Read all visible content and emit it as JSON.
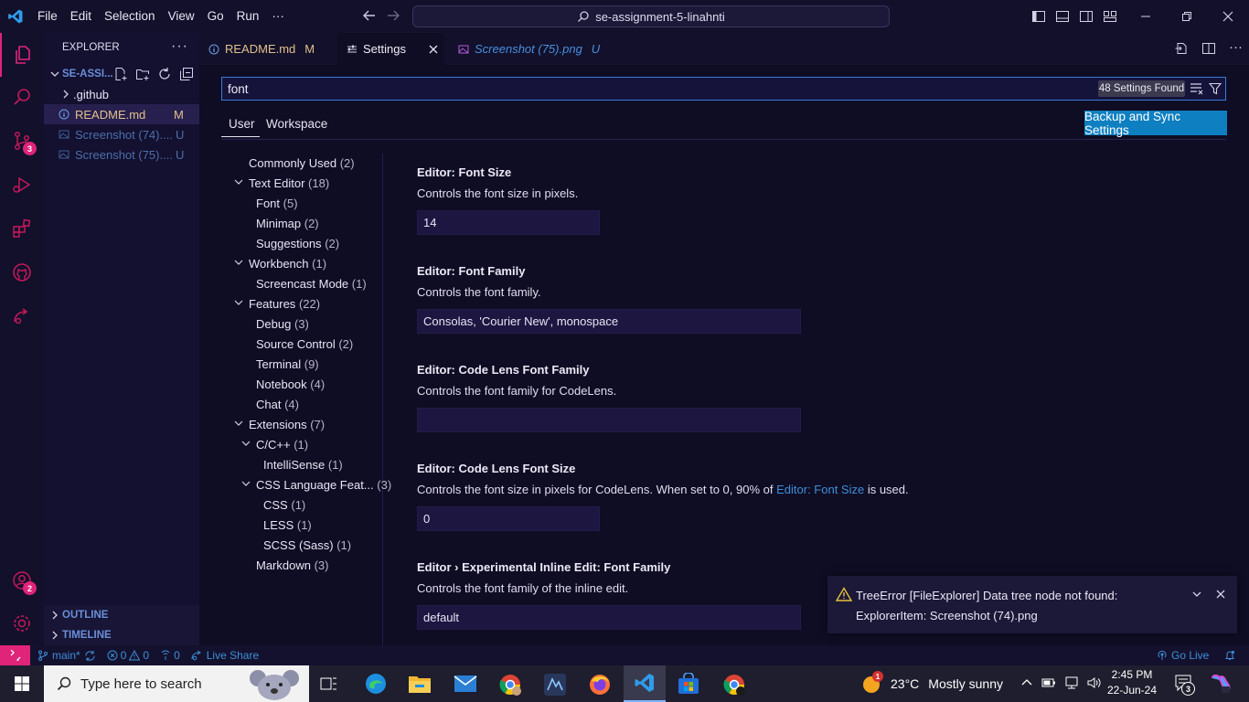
{
  "menu": [
    "File",
    "Edit",
    "Selection",
    "View",
    "Go",
    "Run",
    "···"
  ],
  "command_center": "se-assignment-5-linahnti",
  "activity_badges": {
    "source_control": "3",
    "accounts": "2"
  },
  "explorer": {
    "title": "EXPLORER",
    "folder": "SE-ASSI...",
    "items": [
      {
        "name": ".github",
        "status": ""
      },
      {
        "name": "README.md",
        "status": "M"
      },
      {
        "name": "Screenshot (74)....",
        "status": "U"
      },
      {
        "name": "Screenshot (75)....",
        "status": "U"
      }
    ],
    "outline": "OUTLINE",
    "timeline": "TIMELINE"
  },
  "tabs": [
    {
      "label": "README.md",
      "status": "M"
    },
    {
      "label": "Settings",
      "status": ""
    },
    {
      "label": "Screenshot (75).png",
      "status": "U"
    }
  ],
  "settings": {
    "query": "font",
    "count": "48 Settings Found",
    "scope_tabs": [
      "User",
      "Workspace"
    ],
    "sync_button": "Backup and Sync Settings",
    "toc": [
      {
        "label": "Commonly Used",
        "count": "(2)"
      },
      {
        "label": "Text Editor",
        "count": "(18)"
      },
      {
        "label": "Font",
        "count": "(5)"
      },
      {
        "label": "Minimap",
        "count": "(2)"
      },
      {
        "label": "Suggestions",
        "count": "(2)"
      },
      {
        "label": "Workbench",
        "count": "(1)"
      },
      {
        "label": "Screencast Mode",
        "count": "(1)"
      },
      {
        "label": "Features",
        "count": "(22)"
      },
      {
        "label": "Debug",
        "count": "(3)"
      },
      {
        "label": "Source Control",
        "count": "(2)"
      },
      {
        "label": "Terminal",
        "count": "(9)"
      },
      {
        "label": "Notebook",
        "count": "(4)"
      },
      {
        "label": "Chat",
        "count": "(4)"
      },
      {
        "label": "Extensions",
        "count": "(7)"
      },
      {
        "label": "C/C++",
        "count": "(1)"
      },
      {
        "label": "IntelliSense",
        "count": "(1)"
      },
      {
        "label": "CSS Language Feat...",
        "count": "(3)"
      },
      {
        "label": "CSS",
        "count": "(1)"
      },
      {
        "label": "LESS",
        "count": "(1)"
      },
      {
        "label": "SCSS (Sass)",
        "count": "(1)"
      },
      {
        "label": "Markdown",
        "count": "(3)"
      }
    ],
    "items": [
      {
        "title": "Editor: Font Size",
        "desc": "Controls the font size in pixels.",
        "value": "14"
      },
      {
        "title": "Editor: Font Family",
        "desc": "Controls the font family.",
        "value": "Consolas, 'Courier New', monospace"
      },
      {
        "title": "Editor: Code Lens Font Family",
        "desc": "Controls the font family for CodeLens.",
        "value": ""
      },
      {
        "title": "Editor: Code Lens Font Size",
        "desc_pre": "Controls the font size in pixels for CodeLens. When set to 0, 90% of ",
        "desc_link": "Editor: Font Size",
        "desc_post": " is used.",
        "value": "0"
      },
      {
        "title": "Editor › Experimental Inline Edit: Font Family",
        "desc": "Controls the font family of the inline edit.",
        "value": "default"
      }
    ]
  },
  "notification": {
    "line1": "TreeError [FileExplorer] Data tree node not found:",
    "line2": "ExplorerItem: Screenshot (74).png"
  },
  "statusbar": {
    "branch": "main*",
    "errors": "0",
    "warnings": "0",
    "ports": "0",
    "live_share": "Live Share",
    "go_live": "Go Live"
  },
  "taskbar": {
    "search_placeholder": "Type here to search",
    "weather_temp": "23°C",
    "weather_text": "Mostly sunny",
    "time": "2:45 PM",
    "date": "22-Jun-24",
    "notification_count": "3"
  }
}
